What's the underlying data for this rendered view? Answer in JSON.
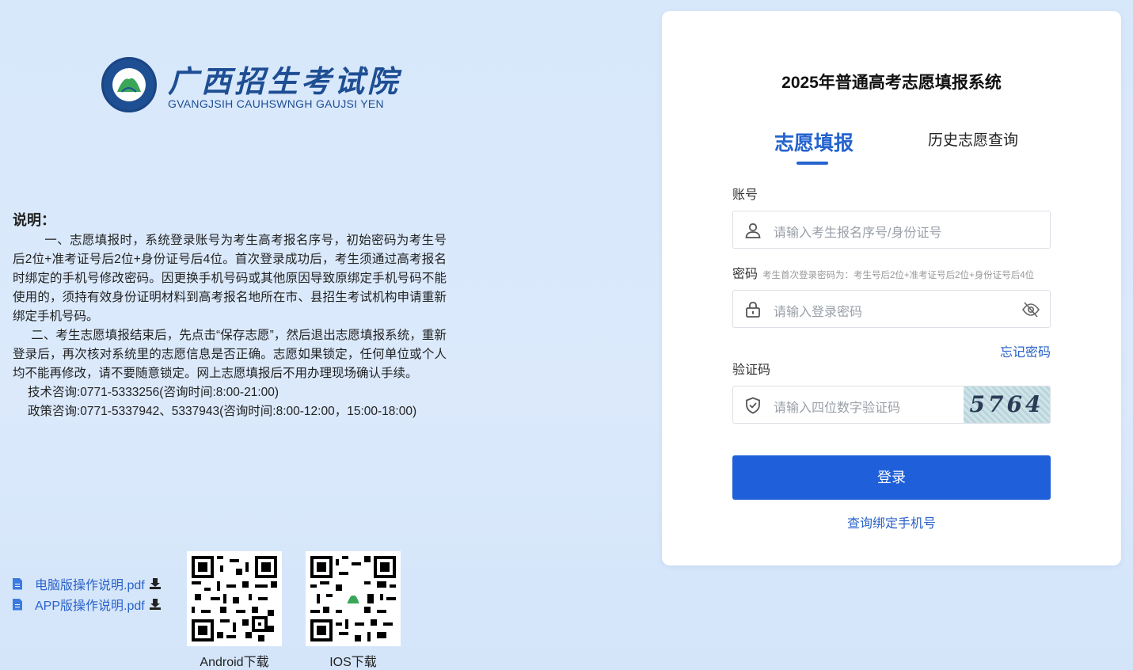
{
  "logo": {
    "title": "广西招生考试院",
    "subtitle": "GVANGJSIH CAUHSWNGH GAUJSI YEN"
  },
  "notes": {
    "title": "说明：",
    "para1": "一、志愿填报时，系统登录账号为考生高考报名序号，初始密码为考生号后2位+准考证号后2位+身份证号后4位。首次登录成功后，考生须通过高考报名时绑定的手机号修改密码。因更换手机号码或其他原因导致原绑定手机号码不能使用的，须持有效身份证明材料到高考报名地所在市、县招生考试机构申请重新绑定手机号码。",
    "para2": "二、考生志愿填报结束后，先点击“保存志愿”，然后退出志愿填报系统，重新登录后，再次核对系统里的志愿信息是否正确。志愿如果锁定，任何单位或个人均不能再修改，请不要随意锁定。网上志愿填报后不用办理现场确认手续。",
    "tech": "技术咨询:0771-5333256(咨询时间:8:00-21:00)",
    "policy": "政策咨询:0771-5337942、5337943(咨询时间:8:00-12:00，15:00-18:00)"
  },
  "downloads": {
    "pc": "电脑版操作说明.pdf",
    "app": "APP版操作说明.pdf"
  },
  "qr": {
    "android": "Android下载",
    "ios": "IOS下载"
  },
  "login": {
    "title": "2025年普通高考志愿填报系统",
    "tab_active": "志愿填报",
    "tab_history": "历史志愿查询",
    "account_label": "账号",
    "account_placeholder": "请输入考生报名序号/身份证号",
    "password_label": "密码",
    "password_hint": "考生首次登录密码为：考生号后2位+准考证号后2位+身份证号后4位",
    "password_placeholder": "请输入登录密码",
    "forgot": "忘记密码",
    "captcha_label": "验证码",
    "captcha_placeholder": "请输入四位数字验证码",
    "captcha_text": "5764",
    "login_button": "登录",
    "query_phone": "查询绑定手机号"
  },
  "colors": {
    "accent": "#1f5fd9",
    "link": "#2a62c9",
    "brand": "#1e4e93"
  }
}
